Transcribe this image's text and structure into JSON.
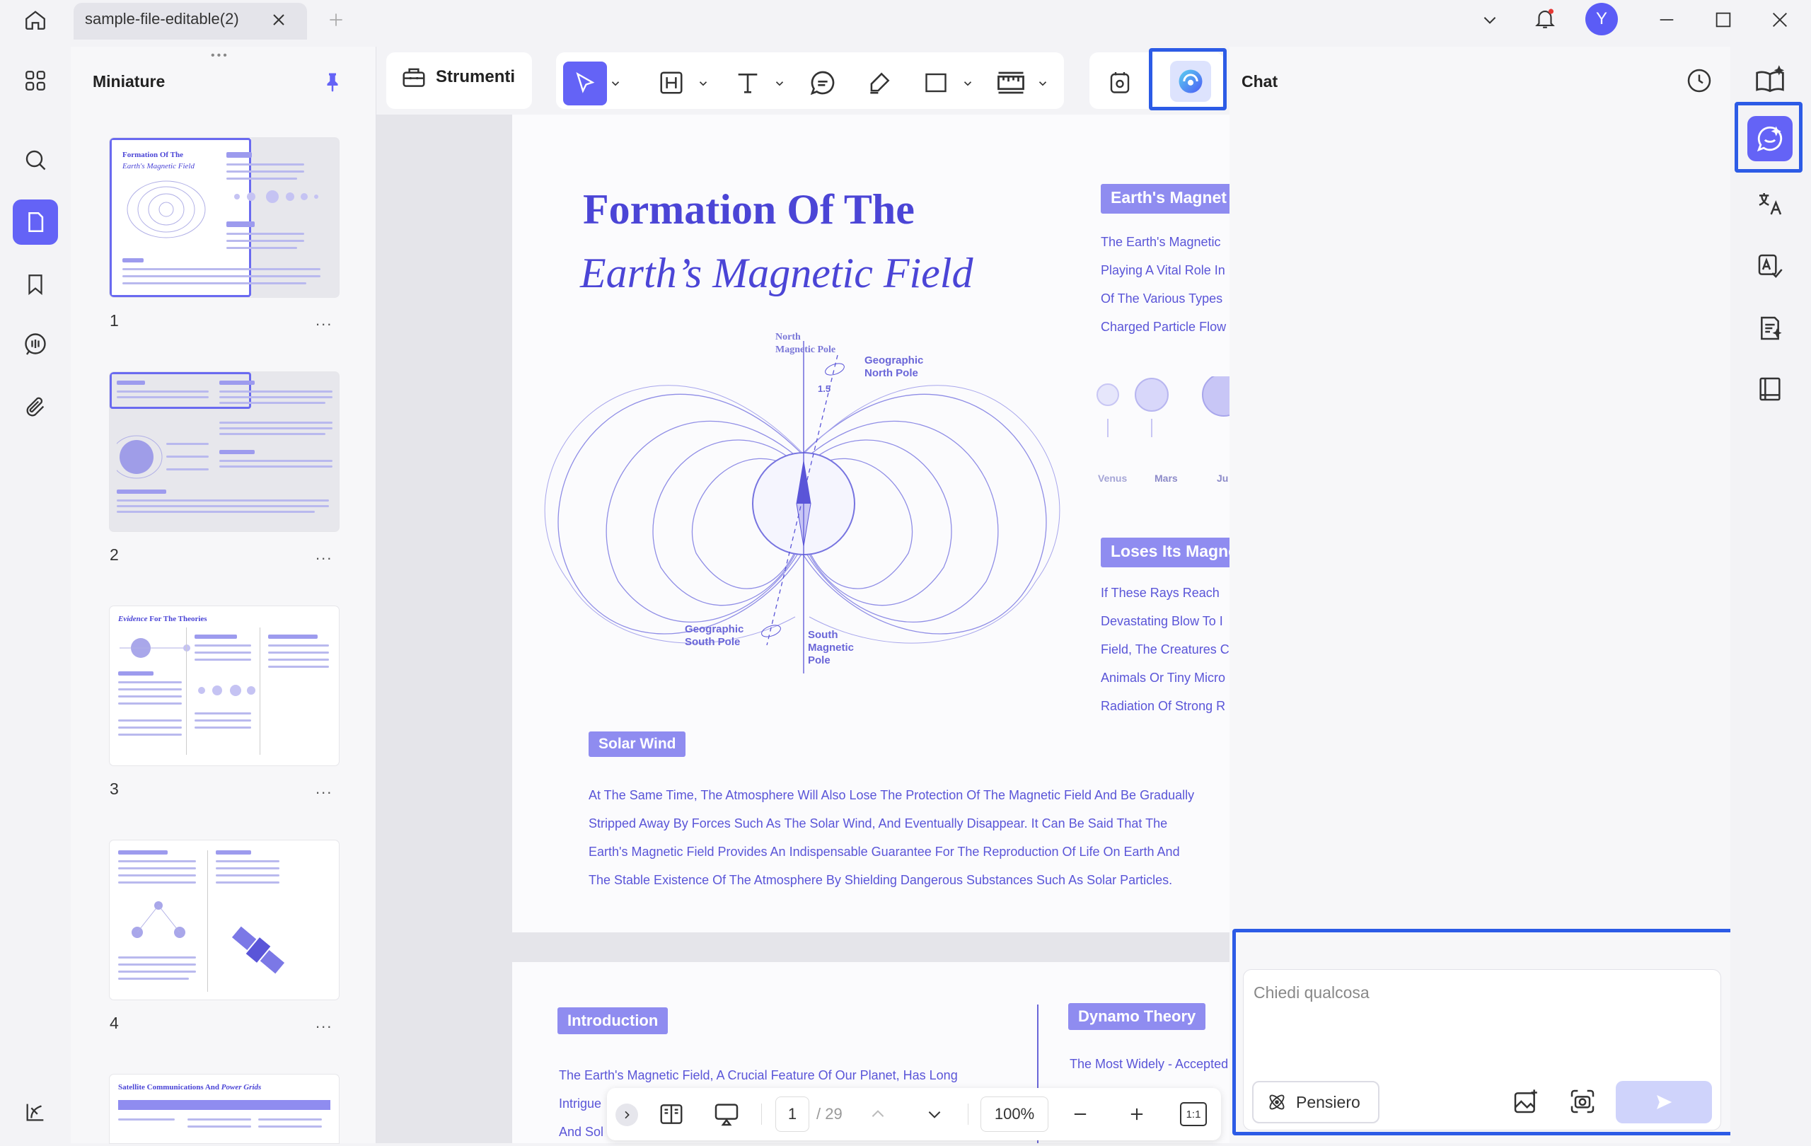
{
  "titlebar": {
    "tab_title": "sample-file-editable(2)",
    "avatar_letter": "Y"
  },
  "thumbnails": {
    "title": "Miniature",
    "pages": [
      {
        "number": "1",
        "more": "..."
      },
      {
        "number": "2",
        "more": "..."
      },
      {
        "number": "3",
        "more": "..."
      },
      {
        "number": "4",
        "more": "..."
      }
    ],
    "thumb3_title_italic": "Evidence",
    "thumb3_title": "For The Theories",
    "thumb5_title": "Satellite Communications And",
    "thumb5_title_italic": "Power Grids"
  },
  "toolbar": {
    "tools_label": "Strumenti"
  },
  "document": {
    "page1": {
      "title_line1": "Formation Of The",
      "title_line2": "Earth’s Magnetic Field",
      "diagram": {
        "north_pole": "North\nMagnetic Pole",
        "north_pole_l1": "North",
        "north_pole_l2": "Magnetic Pole",
        "geo_north_l1": "Geographic",
        "geo_north_l2": "North Pole",
        "angle": "1.5",
        "geo_south_l1": "Geographic",
        "geo_south_l2": "South Pole",
        "south_l1": "South",
        "south_l2": "Magnetic",
        "south_l3": "Pole"
      },
      "section_magnetic": "Earth's Magnet",
      "magnetic_lines": [
        "The Earth's Magnetic",
        "Playing A Vital Role In",
        "Of The Various Types",
        "Charged Particle Flow"
      ],
      "planets": [
        "Venus",
        "Mars",
        "Ju"
      ],
      "section_loses": "Loses Its Magne",
      "loses_lines": [
        "If These Rays Reach",
        "Devastating Blow To I",
        "Field, The Creatures C",
        "Animals Or Tiny Micro",
        "Radiation Of Strong R"
      ],
      "section_solar": "Solar Wind",
      "solar_lines": [
        "At The Same Time, The Atmosphere Will Also Lose The Protection Of The Magnetic Field And Be Gradually",
        "Stripped Away By Forces Such As The Solar Wind, And Eventually Disappear. It Can Be Said That The",
        "Earth's Magnetic Field Provides An Indispensable Guarantee For The Reproduction Of Life On Earth And",
        "The Stable Existence Of The Atmosphere By Shielding Dangerous Substances Such As Solar Particles."
      ]
    },
    "page2": {
      "section_intro": "Introduction",
      "intro_lines": [
        "The Earth's Magnetic Field, A Crucial Feature Of Our Planet, Has Long",
        "Intrigue",
        "And Sol"
      ],
      "section_dynamo": "Dynamo Theory",
      "dynamo_lines": [
        "The Most Widely - Accepted"
      ]
    }
  },
  "bottombar": {
    "page_current": "1",
    "page_total": "/ 29",
    "zoom": "100%",
    "fit_label": "1:1"
  },
  "chat": {
    "title": "Chat",
    "input_placeholder": "Chiedi qualcosa",
    "thinking_label": "Pensiero"
  },
  "colors": {
    "accent": "#6463f6",
    "highlight": "#2c5be6",
    "doc_text": "#5a55d8"
  }
}
